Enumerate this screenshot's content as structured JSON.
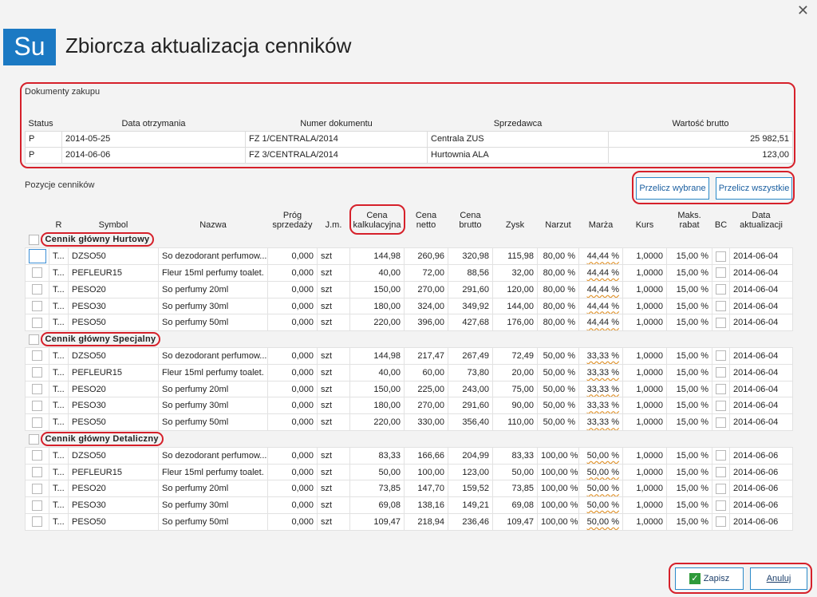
{
  "window": {
    "close_label": "✕"
  },
  "header": {
    "logo_text": "Su",
    "title": "Zbiorcza aktualizacja cenników"
  },
  "documents": {
    "label": "Dokumenty zakupu",
    "columns": [
      "Status",
      "Data otrzymania",
      "Numer dokumentu",
      "Sprzedawca",
      "Wartość brutto"
    ],
    "rows": [
      {
        "status": "P",
        "date": "2014-05-25",
        "number": "FZ 1/CENTRALA/2014",
        "seller": "Centrala ZUS",
        "value": "25 982,51"
      },
      {
        "status": "P",
        "date": "2014-06-06",
        "number": "FZ 3/CENTRALA/2014",
        "seller": "Hurtownia ALA",
        "value": "123,00"
      }
    ]
  },
  "positions": {
    "label": "Pozycje cenników",
    "buttons": {
      "recalc_selected": "Przelicz wybrane",
      "recalc_all": "Przelicz wszystkie"
    },
    "columns": [
      "",
      "R",
      "Symbol",
      "Nazwa",
      "Próg sprzedaży",
      "J.m.",
      "Cena kalkulacyjna",
      "Cena netto",
      "Cena brutto",
      "Zysk",
      "Narzut",
      "Marża",
      "Kurs",
      "Maks. rabat",
      "BC",
      "Data aktualizacji"
    ],
    "groups": [
      {
        "name": "Cennik  główny  Hurtowy",
        "rows": [
          {
            "r": "T...",
            "symbol": "DZSO50",
            "name": "So dezodorant perfumow...",
            "threshold": "0,000",
            "unit": "szt",
            "calc": "144,98",
            "net": "260,96",
            "gross": "320,98",
            "profit": "115,98",
            "markup": "80,00 %",
            "margin": "44,44 %",
            "rate": "1,0000",
            "discount": "15,00 %",
            "date": "2014-06-04"
          },
          {
            "r": "T...",
            "symbol": "PEFLEUR15",
            "name": "Fleur 15ml perfumy toalet.",
            "threshold": "0,000",
            "unit": "szt",
            "calc": "40,00",
            "net": "72,00",
            "gross": "88,56",
            "profit": "32,00",
            "markup": "80,00 %",
            "margin": "44,44 %",
            "rate": "1,0000",
            "discount": "15,00 %",
            "date": "2014-06-04"
          },
          {
            "r": "T...",
            "symbol": "PESO20",
            "name": "So perfumy 20ml",
            "threshold": "0,000",
            "unit": "szt",
            "calc": "150,00",
            "net": "270,00",
            "gross": "291,60",
            "profit": "120,00",
            "markup": "80,00 %",
            "margin": "44,44 %",
            "rate": "1,0000",
            "discount": "15,00 %",
            "date": "2014-06-04"
          },
          {
            "r": "T...",
            "symbol": "PESO30",
            "name": "So perfumy 30ml",
            "threshold": "0,000",
            "unit": "szt",
            "calc": "180,00",
            "net": "324,00",
            "gross": "349,92",
            "profit": "144,00",
            "markup": "80,00 %",
            "margin": "44,44 %",
            "rate": "1,0000",
            "discount": "15,00 %",
            "date": "2014-06-04"
          },
          {
            "r": "T...",
            "symbol": "PESO50",
            "name": "So perfumy 50ml",
            "threshold": "0,000",
            "unit": "szt",
            "calc": "220,00",
            "net": "396,00",
            "gross": "427,68",
            "profit": "176,00",
            "markup": "80,00 %",
            "margin": "44,44 %",
            "rate": "1,0000",
            "discount": "15,00 %",
            "date": "2014-06-04"
          }
        ]
      },
      {
        "name": "Cennik  główny  Specjalny",
        "rows": [
          {
            "r": "T...",
            "symbol": "DZSO50",
            "name": "So dezodorant perfumow...",
            "threshold": "0,000",
            "unit": "szt",
            "calc": "144,98",
            "net": "217,47",
            "gross": "267,49",
            "profit": "72,49",
            "markup": "50,00 %",
            "margin": "33,33 %",
            "rate": "1,0000",
            "discount": "15,00 %",
            "date": "2014-06-04"
          },
          {
            "r": "T...",
            "symbol": "PEFLEUR15",
            "name": "Fleur 15ml perfumy toalet.",
            "threshold": "0,000",
            "unit": "szt",
            "calc": "40,00",
            "net": "60,00",
            "gross": "73,80",
            "profit": "20,00",
            "markup": "50,00 %",
            "margin": "33,33 %",
            "rate": "1,0000",
            "discount": "15,00 %",
            "date": "2014-06-04"
          },
          {
            "r": "T...",
            "symbol": "PESO20",
            "name": "So perfumy 20ml",
            "threshold": "0,000",
            "unit": "szt",
            "calc": "150,00",
            "net": "225,00",
            "gross": "243,00",
            "profit": "75,00",
            "markup": "50,00 %",
            "margin": "33,33 %",
            "rate": "1,0000",
            "discount": "15,00 %",
            "date": "2014-06-04"
          },
          {
            "r": "T...",
            "symbol": "PESO30",
            "name": "So perfumy 30ml",
            "threshold": "0,000",
            "unit": "szt",
            "calc": "180,00",
            "net": "270,00",
            "gross": "291,60",
            "profit": "90,00",
            "markup": "50,00 %",
            "margin": "33,33 %",
            "rate": "1,0000",
            "discount": "15,00 %",
            "date": "2014-06-04"
          },
          {
            "r": "T...",
            "symbol": "PESO50",
            "name": "So perfumy 50ml",
            "threshold": "0,000",
            "unit": "szt",
            "calc": "220,00",
            "net": "330,00",
            "gross": "356,40",
            "profit": "110,00",
            "markup": "50,00 %",
            "margin": "33,33 %",
            "rate": "1,0000",
            "discount": "15,00 %",
            "date": "2014-06-04"
          }
        ]
      },
      {
        "name": "Cennik  główny  Detaliczny",
        "rows": [
          {
            "r": "T...",
            "symbol": "DZSO50",
            "name": "So dezodorant perfumow...",
            "threshold": "0,000",
            "unit": "szt",
            "calc": "83,33",
            "net": "166,66",
            "gross": "204,99",
            "profit": "83,33",
            "markup": "100,00 %",
            "margin": "50,00 %",
            "rate": "1,0000",
            "discount": "15,00 %",
            "date": "2014-06-06"
          },
          {
            "r": "T...",
            "symbol": "PEFLEUR15",
            "name": "Fleur 15ml perfumy toalet.",
            "threshold": "0,000",
            "unit": "szt",
            "calc": "50,00",
            "net": "100,00",
            "gross": "123,00",
            "profit": "50,00",
            "markup": "100,00 %",
            "margin": "50,00 %",
            "rate": "1,0000",
            "discount": "15,00 %",
            "date": "2014-06-06"
          },
          {
            "r": "T...",
            "symbol": "PESO20",
            "name": "So perfumy 20ml",
            "threshold": "0,000",
            "unit": "szt",
            "calc": "73,85",
            "net": "147,70",
            "gross": "159,52",
            "profit": "73,85",
            "markup": "100,00 %",
            "margin": "50,00 %",
            "rate": "1,0000",
            "discount": "15,00 %",
            "date": "2014-06-06"
          },
          {
            "r": "T...",
            "symbol": "PESO30",
            "name": "So perfumy 30ml",
            "threshold": "0,000",
            "unit": "szt",
            "calc": "69,08",
            "net": "138,16",
            "gross": "149,21",
            "profit": "69,08",
            "markup": "100,00 %",
            "margin": "50,00 %",
            "rate": "1,0000",
            "discount": "15,00 %",
            "date": "2014-06-06"
          },
          {
            "r": "T...",
            "symbol": "PESO50",
            "name": "So perfumy 50ml",
            "threshold": "0,000",
            "unit": "szt",
            "calc": "109,47",
            "net": "218,94",
            "gross": "236,46",
            "profit": "109,47",
            "markup": "100,00 %",
            "margin": "50,00 %",
            "rate": "1,0000",
            "discount": "15,00 %",
            "date": "2014-06-06"
          }
        ]
      }
    ]
  },
  "footer": {
    "save_label": "Zapisz",
    "cancel_label": "Anuluj"
  },
  "colors": {
    "accent": "#1b79c3",
    "highlight": "#d6202a",
    "button_border": "#2b8ac9",
    "save_icon": "#2e9a3a"
  },
  "icons": {
    "close": "close-icon",
    "save": "checkmark-icon"
  }
}
